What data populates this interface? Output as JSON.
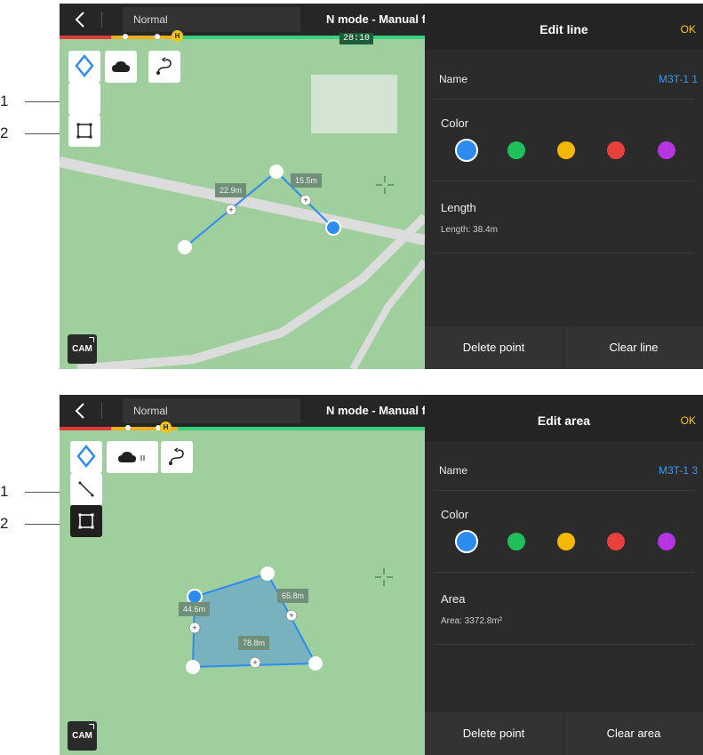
{
  "callouts": [
    "1",
    "2"
  ],
  "screens": [
    {
      "topbar": {
        "mode": "Normal",
        "flight": "N mode - Manual fli",
        "timer": "28:10",
        "h_badge": "H"
      },
      "tools": {
        "cam": "CAM"
      },
      "measurements": [
        "22.9m",
        "15.5m"
      ],
      "panel": {
        "title": "Edit line",
        "ok": "OK",
        "name_label": "Name",
        "name_value": "M3T-1 1",
        "color_label": "Color",
        "colors": [
          "#2d8cf0",
          "#1fbf5a",
          "#f5b800",
          "#e8403a",
          "#b535e0"
        ],
        "selected_color": "#2d8cf0",
        "metric_label": "Length",
        "metric_value": "Length: 38.4m",
        "left_button": "Delete point",
        "right_button": "Clear line"
      },
      "active_tool": "line"
    },
    {
      "topbar": {
        "mode": "Normal",
        "flight": "N mode - Manual fli",
        "h_badge": "H"
      },
      "tools": {
        "cam": "CAM"
      },
      "measurements": [
        "44.6m",
        "65.8m",
        "78.8m"
      ],
      "panel": {
        "title": "Edit area",
        "ok": "OK",
        "name_label": "Name",
        "name_value": "M3T-1 3",
        "color_label": "Color",
        "colors": [
          "#2d8cf0",
          "#1fbf5a",
          "#f5b800",
          "#e8403a",
          "#b535e0"
        ],
        "selected_color": "#2d8cf0",
        "metric_label": "Area",
        "metric_value": "Area: 3372.8m²",
        "left_button": "Delete point",
        "right_button": "Clear area"
      },
      "active_tool": "area"
    }
  ]
}
